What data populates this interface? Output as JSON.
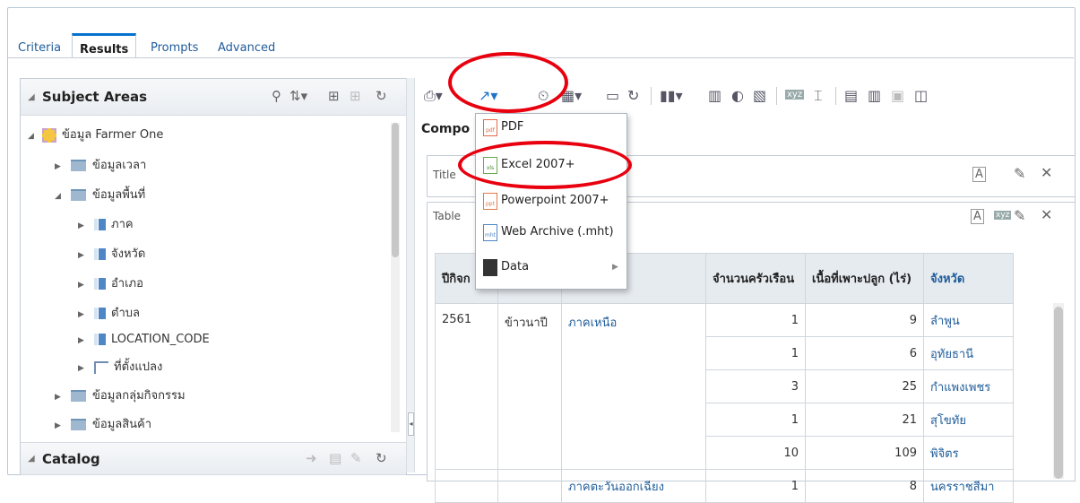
{
  "tabs": [
    "Criteria",
    "Results",
    "Prompts",
    "Advanced"
  ],
  "left_panel": {
    "subject_areas_title": "Subject Areas",
    "tree": [
      {
        "label": "ข้อมูล Farmer One",
        "kind": "subject"
      },
      {
        "label": "ข้อมูลเวลา",
        "kind": "folder"
      },
      {
        "label": "ข้อมูลพื้นที่",
        "kind": "folder"
      },
      {
        "label": "ภาค",
        "kind": "column"
      },
      {
        "label": "จังหวัด",
        "kind": "column"
      },
      {
        "label": "อำเภอ",
        "kind": "column"
      },
      {
        "label": "ตำบล",
        "kind": "column"
      },
      {
        "label": "LOCATION_CODE",
        "kind": "column"
      },
      {
        "label": "ที่ตั้งแปลง",
        "kind": "hierarchy"
      },
      {
        "label": "ข้อมูลกลุ่มกิจกรรม",
        "kind": "folder"
      },
      {
        "label": "ข้อมูลสินค้า",
        "kind": "folder"
      }
    ],
    "catalog_title": "Catalog"
  },
  "compound_label": "Compo",
  "views": {
    "title_label": "Title",
    "table_label": "Table"
  },
  "export_menu": {
    "items": [
      "PDF",
      "Excel 2007+",
      "Powerpoint 2007+",
      "Web Archive (.mht)",
      "Data"
    ],
    "icons": [
      "pdf-icon",
      "xls-icon",
      "ppt-icon",
      "mht-icon",
      "data-icon"
    ]
  },
  "table": {
    "headers": [
      "ปีกิจก",
      "",
      "",
      "จำนวนครัวเรือน",
      "เนื้อที่เพาะปลูก (ไร่)",
      "จังหวัด"
    ],
    "year": "2561",
    "crop": "ข้าวนาปี",
    "region": "ภาคเหนือ",
    "region2": "ภาคตะวันออกเฉียง",
    "rows": [
      {
        "households": "1",
        "area": "9",
        "province": "ลำพูน"
      },
      {
        "households": "1",
        "area": "6",
        "province": "อุทัยธานี"
      },
      {
        "households": "3",
        "area": "25",
        "province": "กำแพงเพชร"
      },
      {
        "households": "1",
        "area": "21",
        "province": "สุโขทัย"
      },
      {
        "households": "10",
        "area": "109",
        "province": "พิจิตร"
      },
      {
        "households": "1",
        "area": "8",
        "province": "นครราชสีมา"
      }
    ]
  },
  "colors": {
    "accent": "#0572ce",
    "highlight_oval": "#e8000f",
    "link": "#1f5c99"
  }
}
